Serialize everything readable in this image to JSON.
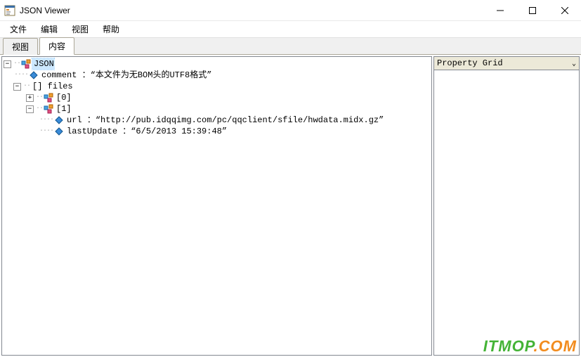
{
  "window": {
    "title": "JSON Viewer"
  },
  "menu": {
    "file": "文件",
    "edit": "编辑",
    "view": "视图",
    "help": "帮助"
  },
  "tabs": {
    "tab0": "视图",
    "tab1": "内容"
  },
  "side": {
    "header": "Property Grid"
  },
  "tree": {
    "root": "JSON",
    "comment_key": "comment",
    "comment_sep": " ：",
    "comment_val": "“本文件为无BOM头的UTF8格式”",
    "files_key": "[] files",
    "item0": "[0]",
    "item1": "[1]",
    "url_key": "url",
    "url_sep": " ：",
    "url_val": "“http://pub.idqqimg.com/pc/qqclient/sfile/hwdata.midx.gz”",
    "lu_key": "lastUpdate",
    "lu_sep": " ：",
    "lu_val": "“6/5/2013 15:39:48”"
  },
  "watermark": {
    "t1": "ITMOP",
    "t2": ".COM"
  }
}
